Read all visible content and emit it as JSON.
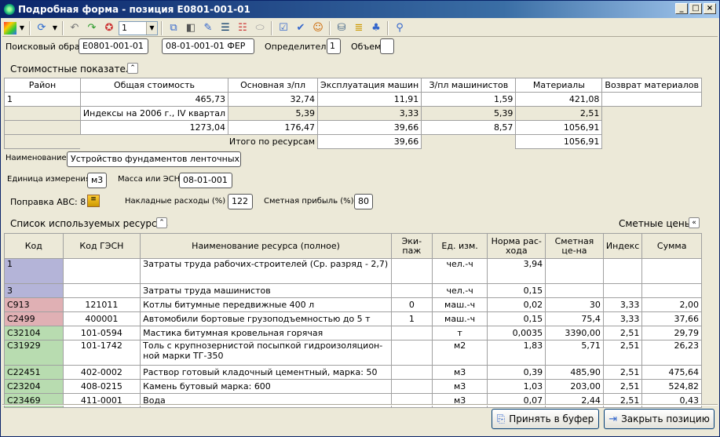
{
  "window": {
    "title": "Подробная форма - позиция Е0801-001-01",
    "min": "_",
    "max": "□",
    "close": "×"
  },
  "toolbar": {
    "combo_value": "1"
  },
  "header": {
    "search_label": "Поисковый образ",
    "search_value": "Е0801-001-01",
    "code_value": "08-01-001-01 ФЕР",
    "det_label": "Определитель",
    "det_value": "1",
    "vol_label": "Объем",
    "vol_value": ""
  },
  "cost": {
    "section_label": "Стоимостные показатели",
    "headers": [
      "Район",
      "Общая стоимость",
      "Основная з/пл",
      "Эксплуатация машин",
      "З/пл машинистов",
      "Материалы",
      "Возврат материалов"
    ],
    "row1": [
      "1",
      "465,73",
      "32,74",
      "11,91",
      "1,59",
      "421,08",
      ""
    ],
    "index_label": "Индексы на 2006 г., IV квартал",
    "index_row": [
      "5,39",
      "3,33",
      "5,39",
      "2,51"
    ],
    "row3": [
      "1273,04",
      "176,47",
      "39,66",
      "8,57",
      "1056,91"
    ],
    "total_label": "Итого по ресурсам",
    "total_row": [
      "39,66",
      "1056,91"
    ]
  },
  "info": {
    "name_label": "Наименование",
    "name_value": "Устройство фундаментов ленточных",
    "unit_label": "Единица измерения",
    "unit_value": "м3",
    "mass_label": "Масса или ЭСН",
    "mass_value": "08-01-001",
    "abc_label": "Поправка АВС: 8",
    "overhead_label": "Накладные расходы (%)",
    "overhead_value": "122",
    "profit_label": "Сметная прибыль (%)",
    "profit_value": "80"
  },
  "resources": {
    "section_label": "Список используемых ресурсов",
    "prices_label": "Сметные цены",
    "headers": [
      "Код",
      "Код ГЭСН",
      "Наименование ресурса (полное)",
      "Эки-паж",
      "Ед. изм.",
      "Норма рас-хода",
      "Сметная це-на",
      "Индекс",
      "Сумма"
    ],
    "rows": [
      {
        "code": "1",
        "gesn": "",
        "name": "Затраты труда рабочих-строителей (Ср. разряд - 2,7)",
        "crew": "",
        "unit": "чел.-ч",
        "norm": "3,94",
        "price": "",
        "index": "",
        "sum": "",
        "color": "#b4b4d8"
      },
      {
        "code": "3",
        "gesn": "",
        "name": "Затраты труда машинистов",
        "crew": "",
        "unit": "чел.-ч",
        "norm": "0,15",
        "price": "",
        "index": "",
        "sum": "",
        "color": "#b4b4d8"
      },
      {
        "code": "С913",
        "gesn": "121011",
        "name": "Котлы битумные передвижные 400 л",
        "crew": "0",
        "unit": "маш.-ч",
        "norm": "0,02",
        "price": "30",
        "index": "3,33",
        "sum": "2,00",
        "color": "#e0b0b4"
      },
      {
        "code": "С2499",
        "gesn": "400001",
        "name": "Автомобили бортовые грузоподъемностью до 5 т",
        "crew": "1",
        "unit": "маш.-ч",
        "norm": "0,15",
        "price": "75,4",
        "index": "3,33",
        "sum": "37,66",
        "color": "#e0b0b4"
      },
      {
        "code": "С32104",
        "gesn": "101-0594",
        "name": "Мастика битумная кровельная горячая",
        "crew": "",
        "unit": "т",
        "norm": "0,0035",
        "price": "3390,00",
        "index": "2,51",
        "sum": "29,79",
        "color": "#b8dcb0"
      },
      {
        "code": "С31929",
        "gesn": "101-1742",
        "name": "Толь с крупнозернистой посыпкой гидроизоляцион-ной марки ТГ-350",
        "crew": "",
        "unit": "м2",
        "norm": "1,83",
        "price": "5,71",
        "index": "2,51",
        "sum": "26,23",
        "color": "#b8dcb0"
      },
      {
        "code": "С22451",
        "gesn": "402-0002",
        "name": "Раствор готовый кладочный цементный, марка: 50",
        "crew": "",
        "unit": "м3",
        "norm": "0,39",
        "price": "485,90",
        "index": "2,51",
        "sum": "475,64",
        "color": "#b8dcb0"
      },
      {
        "code": "С23204",
        "gesn": "408-0215",
        "name": "Камень бутовый марка: 600",
        "crew": "",
        "unit": "м3",
        "norm": "1,03",
        "price": "203,00",
        "index": "2,51",
        "sum": "524,82",
        "color": "#b8dcb0"
      },
      {
        "code": "С23469",
        "gesn": "411-0001",
        "name": "Вода",
        "crew": "",
        "unit": "м3",
        "norm": "0,07",
        "price": "2,44",
        "index": "2,51",
        "sum": "0,43",
        "color": "#b8dcb0"
      }
    ]
  },
  "buttons": {
    "accept": "Принять в буфер",
    "close": "Закрыть позицию"
  }
}
